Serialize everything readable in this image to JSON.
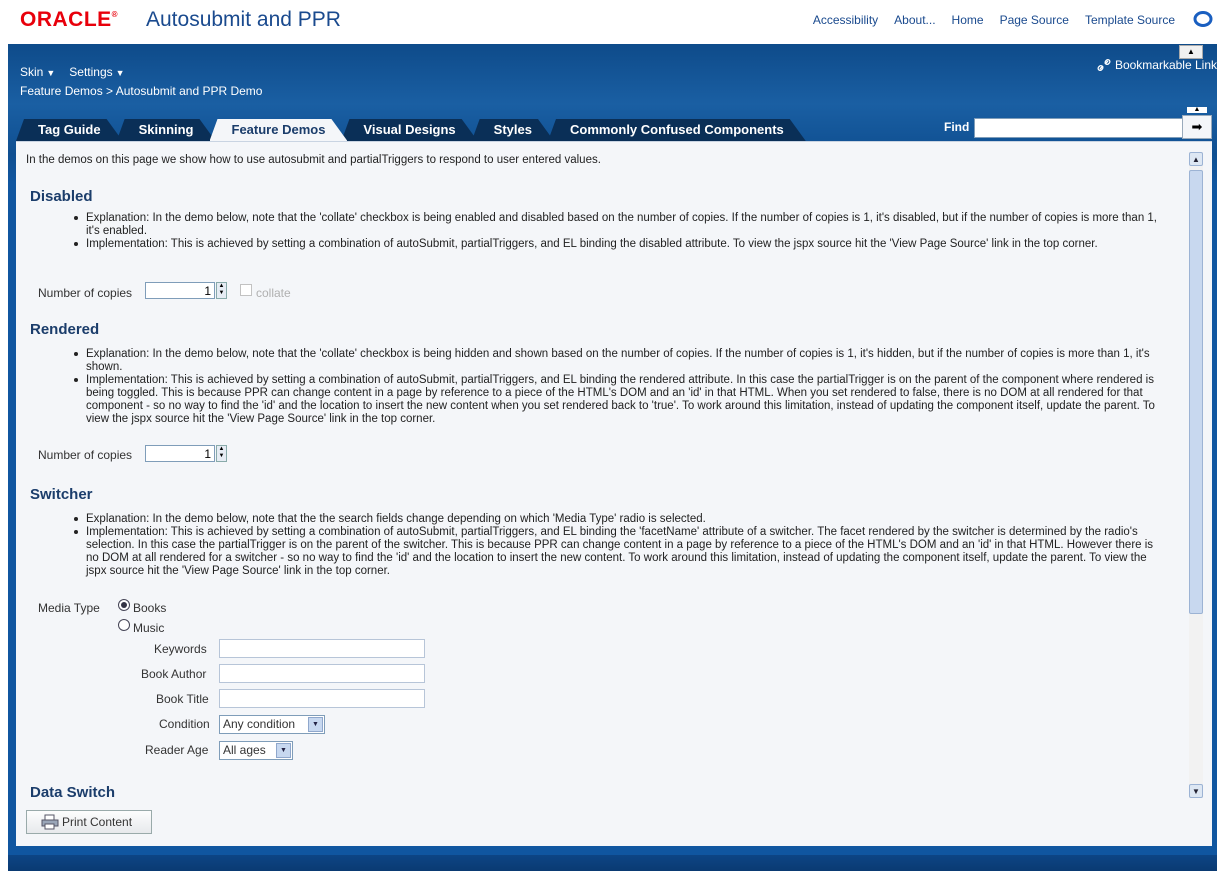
{
  "header": {
    "brand": "ORACLE",
    "app_title": "Autosubmit and PPR",
    "links": [
      "Accessibility",
      "About...",
      "Home",
      "Page Source",
      "Template Source"
    ]
  },
  "menus": {
    "skin": "Skin",
    "settings": "Settings"
  },
  "breadcrumb": {
    "parent": "Feature Demos",
    "separator": ">",
    "current": "Autosubmit and PPR Demo"
  },
  "bookmark": {
    "label": "Bookmarkable Link"
  },
  "tabs": [
    {
      "label": "Tag Guide",
      "active": false
    },
    {
      "label": "Skinning",
      "active": false
    },
    {
      "label": "Feature Demos",
      "active": true
    },
    {
      "label": "Visual Designs",
      "active": false
    },
    {
      "label": "Styles",
      "active": false
    },
    {
      "label": "Commonly Confused Components",
      "active": false
    }
  ],
  "find": {
    "label": "Find",
    "value": ""
  },
  "intro": "In the demos on this page we show how to use autosubmit and partialTriggers to respond to user entered values.",
  "disabled": {
    "heading": "Disabled",
    "bullets": [
      "Explanation: In the demo below, note that the 'collate' checkbox is being enabled and disabled based on the number of copies. If the number of copies is 1, it's disabled, but if the number of copies is more than 1, it's enabled.",
      "Implementation: This is achieved by setting a combination of autoSubmit, partialTriggers, and EL binding the disabled attribute. To view the jspx source hit the 'View Page Source' link in the top corner."
    ],
    "copies_label": "Number of copies",
    "copies_value": "1",
    "collate_label": "collate"
  },
  "rendered": {
    "heading": "Rendered",
    "bullets": [
      "Explanation: In the demo below, note that the 'collate' checkbox is being hidden and shown based on the number of copies. If the number of copies is 1, it's hidden, but if the number of copies is more than 1, it's shown.",
      "Implementation: This is achieved by setting a combination of autoSubmit, partialTriggers, and EL binding the rendered attribute. In this case the partialTrigger is on the parent of the component where rendered is being toggled. This is because PPR can change content in a page by reference to a piece of the HTML's DOM and an 'id' in that HTML. When you set rendered to false, there is no DOM at all rendered for that component - so no way to find the 'id' and the location to insert the new content when you set rendered back to 'true'. To work around this limitation, instead of updating the component itself, update the parent. To view the jspx source hit the 'View Page Source' link in the top corner."
    ],
    "copies_label": "Number of copies",
    "copies_value": "1"
  },
  "switcher": {
    "heading": "Switcher",
    "bullets": [
      "Explanation: In the demo below, note that the the search fields change depending on which 'Media Type' radio is selected.",
      "Implementation: This is achieved by setting a combination of autoSubmit, partialTriggers, and EL binding the 'facetName' attribute of a switcher. The facet rendered by the switcher is determined by the radio's selection. In this case the partialTrigger is on the parent of the switcher. This is because PPR can change content in a page by reference to a piece of the HTML's DOM and an 'id' in that HTML. However there is no DOM at all rendered for a switcher - so no way to find the 'id' and the location to insert the new content. To work around this limitation, instead of updating the component itself, update the parent. To view the jspx source hit the 'View Page Source' link in the top corner."
    ],
    "media_type_label": "Media Type",
    "options": [
      "Books",
      "Music"
    ],
    "selected": "Books",
    "keywords_label": "Keywords",
    "author_label": "Book Author",
    "title_label": "Book Title",
    "condition_label": "Condition",
    "condition_value": "Any condition",
    "age_label": "Reader Age",
    "age_value": "All ages"
  },
  "data_switch": {
    "heading": "Data Switch",
    "print_label": "Print Content"
  },
  "colors": {
    "brand_red": "#e8000b",
    "link_blue": "#1a4a8e",
    "frame_blue": "#0f4f91",
    "heading_blue": "#1b3d6b"
  }
}
